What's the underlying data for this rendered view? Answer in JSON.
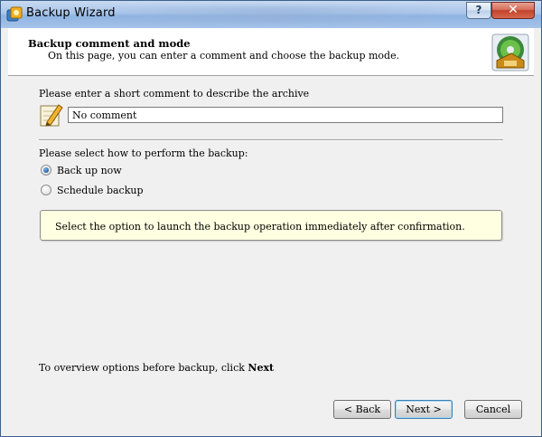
{
  "window": {
    "title": "Backup Wizard"
  },
  "header": {
    "title": "Backup comment and mode",
    "subtitle": "On this page, you can enter a comment and choose the backup mode."
  },
  "comment": {
    "label": "Please enter a short comment to describe the archive",
    "value": "No comment"
  },
  "mode": {
    "label": "Please select how to perform the backup:",
    "options": [
      {
        "label": "Back up now",
        "checked": true
      },
      {
        "label": "Schedule backup",
        "checked": false
      }
    ],
    "info": "Select the option to launch the backup operation immediately after confirmation."
  },
  "footer": {
    "hint_prefix": "To overview options before backup, click ",
    "hint_bold": "Next"
  },
  "buttons": {
    "back": "< Back",
    "next": "Next >",
    "cancel": "Cancel"
  },
  "caption": {
    "help": "?",
    "close": "✕"
  },
  "icons": {
    "app": "backup-app-icon",
    "header": "backup-disc-icon",
    "comment": "pencil-note-icon"
  }
}
